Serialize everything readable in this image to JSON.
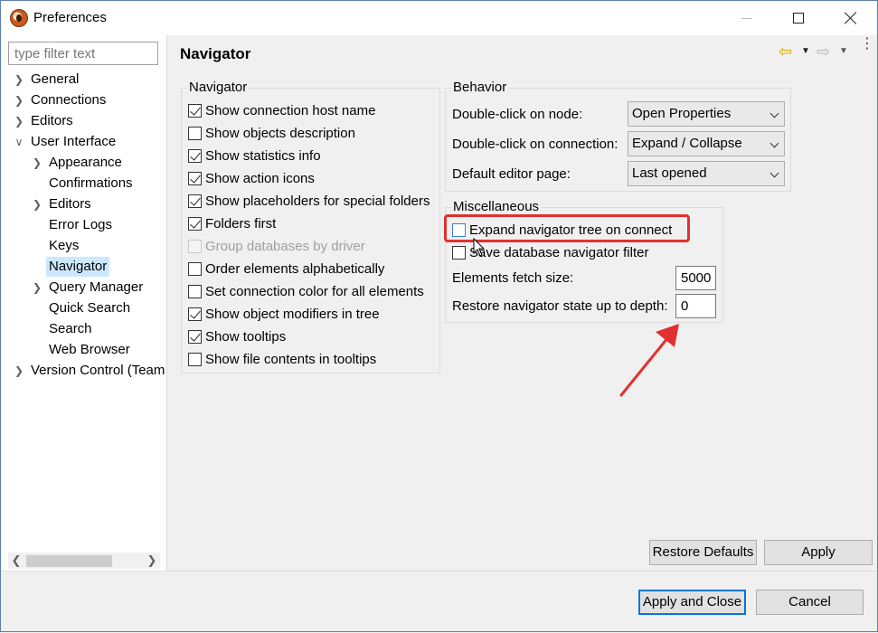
{
  "window": {
    "title": "Preferences"
  },
  "filter": {
    "placeholder": "type filter text"
  },
  "tree": [
    {
      "label": "General",
      "level": 0,
      "expander": "collapsed"
    },
    {
      "label": "Connections",
      "level": 0,
      "expander": "collapsed"
    },
    {
      "label": "Editors",
      "level": 0,
      "expander": "collapsed"
    },
    {
      "label": "User Interface",
      "level": 0,
      "expander": "expanded"
    },
    {
      "label": "Appearance",
      "level": 1,
      "expander": "collapsed"
    },
    {
      "label": "Confirmations",
      "level": 1,
      "expander": "none"
    },
    {
      "label": "Editors",
      "level": 1,
      "expander": "collapsed"
    },
    {
      "label": "Error Logs",
      "level": 1,
      "expander": "none"
    },
    {
      "label": "Keys",
      "level": 1,
      "expander": "none"
    },
    {
      "label": "Navigator",
      "level": 1,
      "expander": "none",
      "selected": true
    },
    {
      "label": "Query Manager",
      "level": 1,
      "expander": "collapsed"
    },
    {
      "label": "Quick Search",
      "level": 1,
      "expander": "none"
    },
    {
      "label": "Search",
      "level": 1,
      "expander": "none"
    },
    {
      "label": "Web Browser",
      "level": 1,
      "expander": "none"
    },
    {
      "label": "Version Control (Team",
      "level": 0,
      "expander": "collapsed"
    }
  ],
  "page": {
    "title": "Navigator"
  },
  "navigator_group": {
    "title": "Navigator",
    "items": [
      {
        "label": "Show connection host name",
        "checked": true,
        "enabled": true
      },
      {
        "label": "Show objects description",
        "checked": false,
        "enabled": true
      },
      {
        "label": "Show statistics info",
        "checked": true,
        "enabled": true
      },
      {
        "label": "Show action icons",
        "checked": true,
        "enabled": true
      },
      {
        "label": "Show placeholders for special folders",
        "checked": true,
        "enabled": true
      },
      {
        "label": "Folders first",
        "checked": true,
        "enabled": true
      },
      {
        "label": "Group databases by driver",
        "checked": false,
        "enabled": false
      },
      {
        "label": "Order elements alphabetically",
        "checked": false,
        "enabled": true
      },
      {
        "label": "Set connection color for all elements",
        "checked": false,
        "enabled": true
      },
      {
        "label": "Show object modifiers in tree",
        "checked": true,
        "enabled": true
      },
      {
        "label": "Show tooltips",
        "checked": true,
        "enabled": true
      },
      {
        "label": "Show file contents in tooltips",
        "checked": false,
        "enabled": true
      }
    ]
  },
  "behavior_group": {
    "title": "Behavior",
    "rows": [
      {
        "label": "Double-click on node:",
        "value": "Open Properties"
      },
      {
        "label": "Double-click on connection:",
        "value": "Expand / Collapse"
      },
      {
        "label": "Default editor page:",
        "value": "Last opened"
      }
    ]
  },
  "misc_group": {
    "title": "Miscellaneous",
    "checks": [
      {
        "label": "Expand navigator tree on connect",
        "checked": false
      },
      {
        "label": "Save database navigator filter",
        "checked": false
      }
    ],
    "fetch_label": "Elements fetch size:",
    "fetch_value": "5000",
    "depth_label": "Restore navigator state up to depth:",
    "depth_value": "0"
  },
  "buttons": {
    "restore_defaults": "Restore Defaults",
    "apply": "Apply",
    "apply_and_close": "Apply and Close",
    "cancel": "Cancel"
  },
  "colors": {
    "selection": "#cce8ff",
    "annotation": "#e0312f",
    "default_button_border": "#0078d7"
  }
}
